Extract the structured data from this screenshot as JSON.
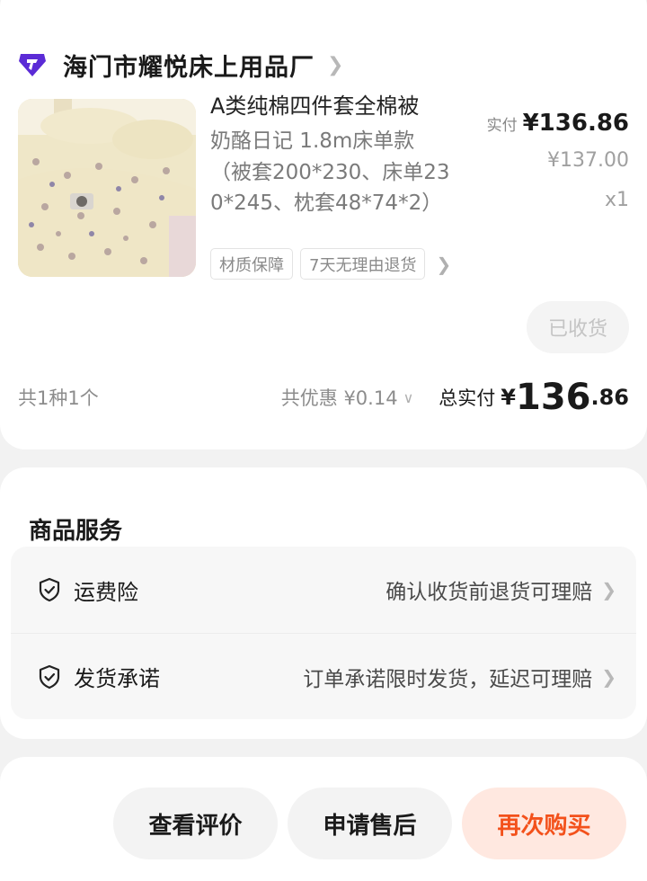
{
  "shop": {
    "name": "海门市耀悦床上用品厂",
    "logo_icon": "shop-diamond-logo"
  },
  "product": {
    "title": "A类纯棉四件套全棉被",
    "spec_lines": [
      "奶酪日记 1.8m床单款",
      "（被套200*230、床单23",
      "0*245、枕套48*74*2）"
    ],
    "paid_label": "实付",
    "paid_price": "¥136.86",
    "original_price": "¥137.00",
    "quantity": "x1",
    "tags": [
      "材质保障",
      "7天无理由退货"
    ],
    "status_button": "已收货"
  },
  "summary": {
    "count": "共1种1个",
    "discount": "共优惠 ¥0.14",
    "total_label": "总实付",
    "total_yen": "¥",
    "total_int": "136",
    "total_dec": ".86"
  },
  "services": {
    "title": "商品服务",
    "items": [
      {
        "name": "运费险",
        "desc": "确认收货前退货可理赔"
      },
      {
        "name": "发货承诺",
        "desc": "订单承诺限时发货，延迟可理赔"
      }
    ]
  },
  "actions": {
    "review": "查看评价",
    "after_sale": "申请售后",
    "rebuy": "再次购买"
  },
  "colors": {
    "accent": "#f3511b",
    "accent_bg": "#ffe8e0",
    "logo": "#5b2bd6"
  }
}
